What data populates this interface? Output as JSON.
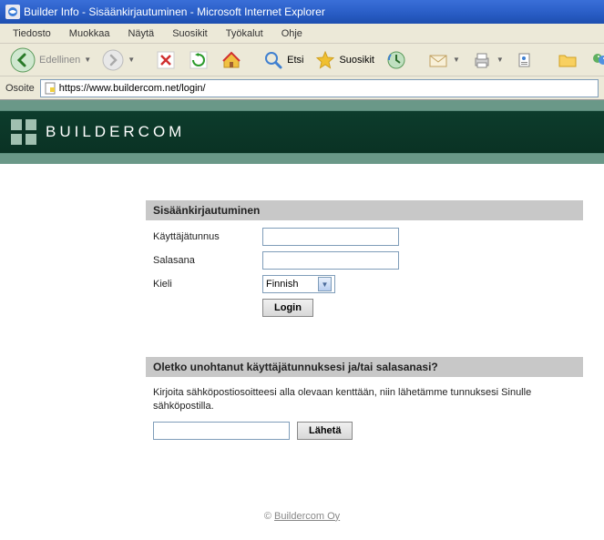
{
  "window": {
    "title": "Builder Info - Sisäänkirjautuminen - Microsoft Internet Explorer"
  },
  "menu": {
    "file": "Tiedosto",
    "edit": "Muokkaa",
    "view": "Näytä",
    "favorites": "Suosikit",
    "tools": "Työkalut",
    "help": "Ohje"
  },
  "toolbar": {
    "back": "Edellinen",
    "search": "Etsi",
    "favorites": "Suosikit"
  },
  "address": {
    "label": "Osoite",
    "url": "https://www.buildercom.net/login/"
  },
  "brand": {
    "name": "BUILDERCOM"
  },
  "login": {
    "title": "Sisäänkirjautuminen",
    "username_label": "Käyttäjätunnus",
    "username_value": "",
    "password_label": "Salasana",
    "password_value": "",
    "language_label": "Kieli",
    "language_value": "Finnish",
    "submit": "Login"
  },
  "forgot": {
    "title": "Oletko unohtanut käyttäjätunnuksesi ja/tai salasanasi?",
    "text": "Kirjoita sähköpostiosoitteesi alla olevaan kenttään, niin lähetämme tunnuksesi Sinulle sähköpostilla.",
    "email_value": "",
    "submit": "Lähetä"
  },
  "footer": {
    "copyright": "©",
    "company": "Buildercom Oy"
  }
}
